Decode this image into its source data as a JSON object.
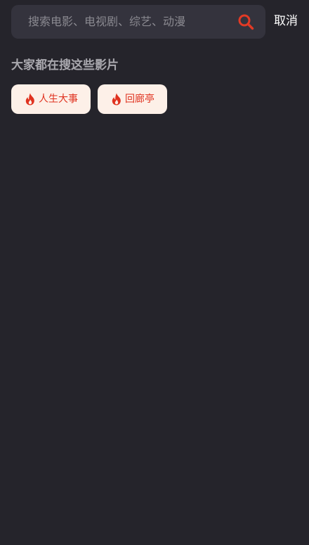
{
  "search": {
    "placeholder": "搜索电影、电视剧、综艺、动漫",
    "icon": "search-icon",
    "icon_color": "#e23a25"
  },
  "header": {
    "cancel_label": "取消"
  },
  "hot_searches": {
    "title": "大家都在搜这些影片",
    "items": [
      {
        "label": "人生大事",
        "icon": "fire-icon"
      },
      {
        "label": "回廊亭",
        "icon": "fire-icon"
      }
    ]
  },
  "colors": {
    "background": "#25242b",
    "search_box": "#34333d",
    "tag_background": "#fdf0e8",
    "accent": "#e0321f"
  }
}
